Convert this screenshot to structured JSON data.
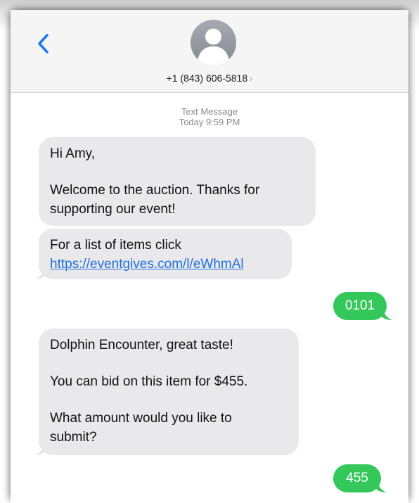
{
  "header": {
    "back_icon": "chevron-left-icon",
    "avatar_icon": "person-silhouette-icon",
    "contact_name": "+1 (843) 606-5818",
    "contact_chevron": "›"
  },
  "thread": {
    "service": "Text Message",
    "timestamp": "Today 9:59 PM"
  },
  "messages": [
    {
      "direction": "incoming",
      "lines": [
        "Hi Amy,",
        "Welcome to the auction. Thanks for",
        "supporting our event!"
      ]
    },
    {
      "direction": "incoming",
      "text": "For a list of items click",
      "link": "https://eventgives.com/l/eWhmAl"
    },
    {
      "direction": "outgoing",
      "text": "0101"
    },
    {
      "direction": "incoming",
      "lines": [
        "Dolphin Encounter, great taste!",
        "You can bid on this item for $455.",
        "What amount would you like to",
        "submit?"
      ]
    },
    {
      "direction": "outgoing",
      "text": "455"
    }
  ],
  "colors": {
    "incoming_bubble": "#e9e9eb",
    "outgoing_bubble": "#34c759",
    "accent": "#1a7cf5",
    "link": "#1f6fe0"
  }
}
